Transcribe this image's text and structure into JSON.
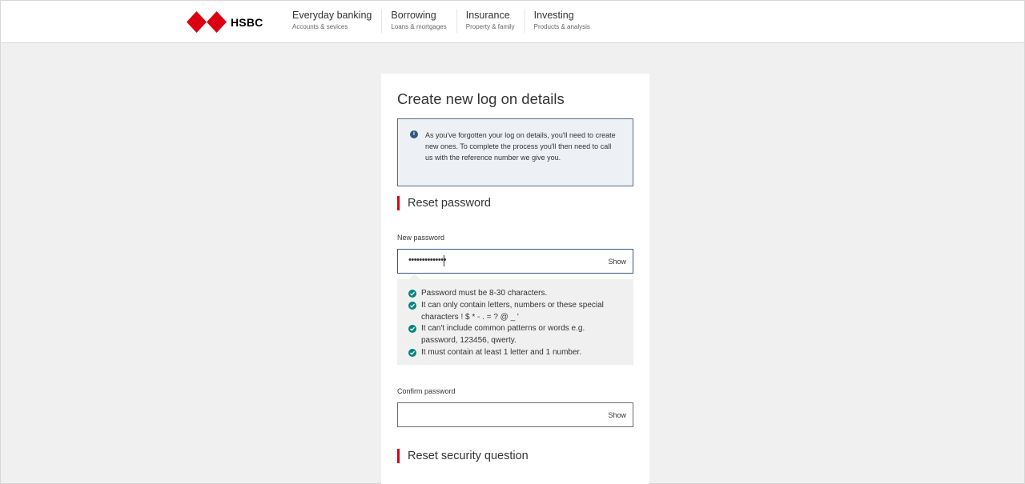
{
  "header": {
    "logo_text": "HSBC",
    "brand_color": "#db0011",
    "nav": [
      {
        "title": "Everyday banking",
        "subtitle": "Accounts & sevices"
      },
      {
        "title": "Borrowing",
        "subtitle": "Loans & mortgages"
      },
      {
        "title": "Insurance",
        "subtitle": "Property & family"
      },
      {
        "title": "Investing",
        "subtitle": "Products & analysis"
      }
    ]
  },
  "form": {
    "title": "Create new log on details",
    "info_icon": "info-icon",
    "info_text": "As you've forgotten your log on details, you'll need to create new ones. To complete the process you'll then need to call us with the reference number we give you.",
    "section_password": "Reset password",
    "new_password_label": "New password",
    "new_password_value": "••••••••••••••",
    "show_label": "Show",
    "rules": [
      "Password must be 8-30 characters.",
      "It can only contain letters, numbers or these special characters ! $ * - . = ? @ _ '",
      "It can't include common patterns or words e.g. password, 123456, qwerty.",
      "It must contain at least 1 letter and 1 number."
    ],
    "rule_status_color": "#00847f",
    "confirm_password_label": "Confirm password",
    "confirm_password_value": "",
    "section_security": "Reset security question"
  }
}
